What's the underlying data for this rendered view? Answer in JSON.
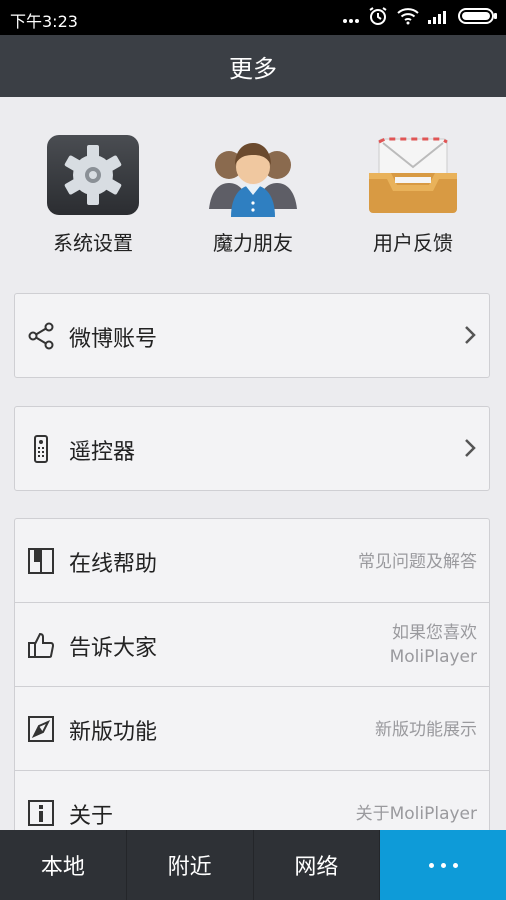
{
  "status_bar": {
    "time": "下午3:23",
    "icons": [
      "dots-icon",
      "alarm-icon",
      "wifi-icon",
      "signal-icon",
      "battery-icon"
    ]
  },
  "header": {
    "title": "更多"
  },
  "quick_actions": [
    {
      "label": "系统设置",
      "icon": "gear-icon"
    },
    {
      "label": "魔力朋友",
      "icon": "friends-icon"
    },
    {
      "label": "用户反馈",
      "icon": "mail-tray-icon"
    }
  ],
  "list_items": {
    "weibo": {
      "label": "微博账号",
      "icon": "share-icon"
    },
    "remote": {
      "label": "遥控器",
      "icon": "remote-icon"
    },
    "help": {
      "label": "在线帮助",
      "hint": "常见问题及解答",
      "icon": "book-icon"
    },
    "tell": {
      "label": "告诉大家",
      "hint_line1": "如果您喜欢",
      "hint_line2": "MoliPlayer",
      "icon": "thumbs-up-icon"
    },
    "new_features": {
      "label": "新版功能",
      "hint": "新版功能展示",
      "icon": "compass-icon"
    },
    "about": {
      "label": "关于",
      "hint": "关于MoliPlayer",
      "icon": "info-icon"
    }
  },
  "tabs": [
    {
      "label": "本地"
    },
    {
      "label": "附近"
    },
    {
      "label": "网络"
    },
    {
      "label": "",
      "icon": "more-dots-icon",
      "active": true
    }
  ],
  "colors": {
    "header_bg": "#3b3f45",
    "tabbar_bg": "#2e3136",
    "active_tab": "#0e9bd8",
    "page_bg": "#ececef"
  }
}
